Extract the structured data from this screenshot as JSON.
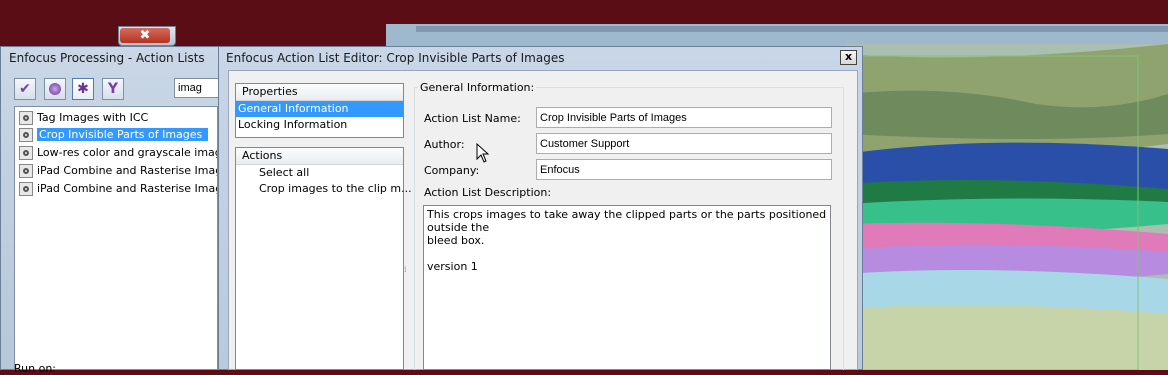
{
  "colors": {
    "desktop": "#5a0d14",
    "selection": "#3399ff"
  },
  "processing_window": {
    "title": "Enfocus Processing - Action Lists",
    "close_glyph": "✖",
    "toolbar": [
      "check-icon",
      "globe-icon",
      "gear-icon",
      "filter-icon"
    ],
    "search_value": "imag",
    "items": [
      {
        "label": "Tag Images with ICC",
        "selected": false
      },
      {
        "label": "Crop Invisible Parts of Images",
        "selected": true
      },
      {
        "label": "Low-res color and grayscale images: v",
        "selected": false
      },
      {
        "label": "iPad Combine and Rasterise Images t",
        "selected": false
      },
      {
        "label": "iPad Combine and Rasterise Images t",
        "selected": false
      }
    ],
    "footer_label": "Run on:"
  },
  "editor": {
    "title": "Enfocus Action List Editor: Crop Invisible Parts of Images",
    "close_glyph": "x",
    "properties_header": "Properties",
    "properties_items": [
      "General Information",
      "Locking Information"
    ],
    "actions_header": "Actions",
    "actions_items": [
      "Select all",
      "Crop images to the clip m..."
    ],
    "group_label": "General Information:",
    "fields": {
      "name_label": "Action List Name:",
      "name_value": "Crop Invisible Parts of Images",
      "author_label": "Author:",
      "author_value": "Customer Support",
      "company_label": "Company:",
      "company_value": "Enfocus",
      "desc_label": "Action List Description:",
      "desc_value": "This crops images to take away the clipped parts or the parts positioned outside the\nbleed box.\n\nversion 1"
    }
  }
}
